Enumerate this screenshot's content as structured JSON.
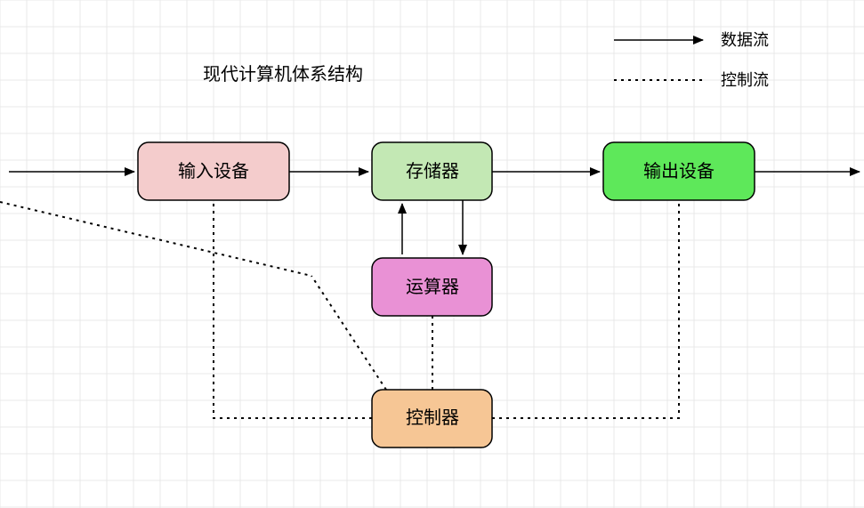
{
  "title": "现代计算机体系结构",
  "legend": {
    "data_flow": "数据流",
    "control_flow": "控制流"
  },
  "nodes": {
    "input": "输入设备",
    "storage": "存储器",
    "output": "输出设备",
    "alu": "运算器",
    "controller": "控制器"
  },
  "colors": {
    "input": "#F4CCCC",
    "storage": "#C3E8B4",
    "output": "#5EE85A",
    "alu": "#E991D5",
    "controller": "#F6C695"
  }
}
